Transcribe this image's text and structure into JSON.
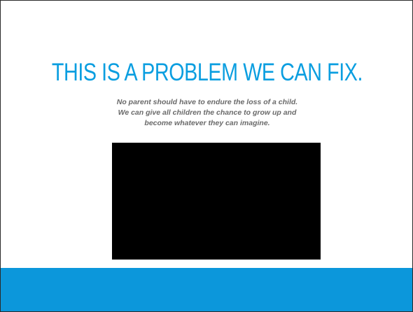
{
  "slide": {
    "headline": "THIS IS A PROBLEM WE CAN FIX.",
    "subtext_lines": [
      "No parent should have to endure the loss of a child.",
      "We can give all children the chance to grow up and",
      "become whatever they can imagine."
    ]
  },
  "colors": {
    "accent": "#0a9ee0",
    "footer": "#0c97db",
    "text_gray": "#6a6a6a",
    "video_bg": "#000000"
  }
}
